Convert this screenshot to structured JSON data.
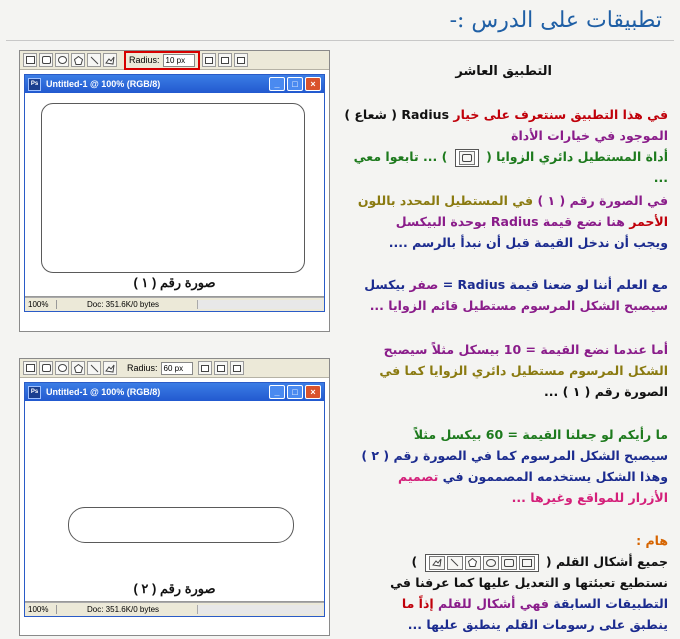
{
  "page": {
    "heading": "تطبيقات على الدرس :-"
  },
  "lesson": {
    "title": "التطبيق العاشر"
  },
  "windows": [
    {
      "radius_label": "Radius:",
      "radius_value": "10 px",
      "title": "Untitled-1 @ 100% (RGB/8)",
      "zoom": "100%",
      "doc": "Doc: 351.6K/0 bytes",
      "caption": "صورة رقم ( ١ )"
    },
    {
      "radius_label": "Radius:",
      "radius_value": "60 px",
      "title": "Untitled-1 @ 100% (RGB/8)",
      "zoom": "100%",
      "doc": "Doc: 351.6K/0 bytes",
      "caption": "صورة رقم ( ٢ )"
    }
  ],
  "paragraphs": {
    "p1": {
      "a": "في هذا التطبيق سنتعرف على خيار ",
      "b": "Radius ( شعاع ) ",
      "c": "الموجود في خيارات الأداة ",
      "d": "أداة المستطيل دائري الزوايا ( ",
      "e": " ) ... تابعوا معي ..."
    },
    "p2": {
      "a": "في الصورة رقم ( ١ ) ",
      "b": "في المستطيل المحدد باللون ",
      "c": "الأحمر ",
      "d": "هنا نضع قيمة Radius بوحدة البيكسل ",
      "e": "ويجب أن ندخل القيمة قبل أن نبدأ بالرسم ...."
    },
    "p3": {
      "a": "مع العلم أننا لو ضعنا قيمة Radius = ",
      "b": "صفر ",
      "c": "بيكسل ",
      "d": "سيصبح الشكل المرسوم مستطيل قائم الزوايا ..."
    },
    "p4": {
      "a": "أما عندما نضع القيمة = 10 بيسكل مثلاً سيصبح ",
      "b": "الشكل المرسوم مستطيل دائري الزوايا كما في ",
      "c": "الصورة رقم ( ١ ) ..."
    },
    "p5": {
      "a": "ما رأيكم لو جعلنا القيمة = 60 بيكسل مثلاً ",
      "b": "سيصبح الشكل المرسوم كما في الصورة رقم ( ٢ ) ",
      "c": "وهذا الشكل يستخدمه المصممون في ",
      "d": "تصميم ",
      "e": "الأزرار للمواقع وغيرها ..."
    },
    "p6": {
      "label": "هام :",
      "a": "جميع أشكال القلم ( ",
      "b": " ) ",
      "c": "نستطيع تعبئتها و التعديل عليها كما عرفنا في ",
      "d": "التطبيقات السابقة ",
      "e": "فهي أشكال للقلم ",
      "f": "إذاً ما ",
      "g": "ينطبق على رسومات القلم ينطبق عليها ..."
    }
  },
  "icons": {
    "toolbar": [
      "rectangle-tool-icon",
      "rounded-rectangle-tool-icon",
      "ellipse-tool-icon",
      "polygon-tool-icon",
      "line-tool-icon",
      "custom-shape-tool-icon"
    ]
  },
  "colors": {
    "highlight": "#d60000",
    "heading": "#1f5fa5"
  }
}
